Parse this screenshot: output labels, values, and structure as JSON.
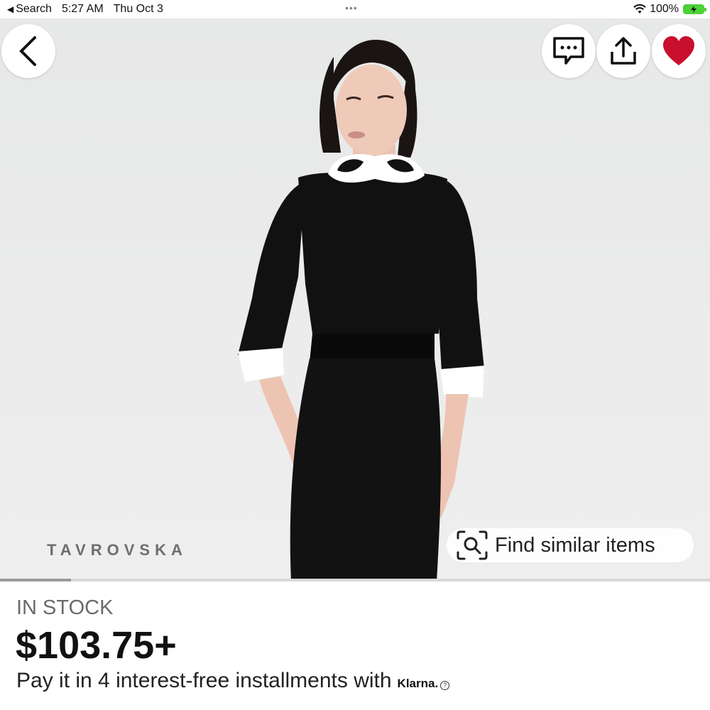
{
  "status_bar": {
    "back_app": "Search",
    "time": "5:27 AM",
    "date": "Thu Oct 3",
    "battery": "100%"
  },
  "photo": {
    "brand_watermark": "TAVROVSKA",
    "find_similar_label": "Find similar items",
    "image_position_fraction": 0.1
  },
  "product": {
    "stock_status": "IN STOCK",
    "price": "$103.75+",
    "installments_text": "Pay it in 4 interest-free installments with",
    "klarna_logo": "Klarna."
  },
  "icons": {
    "back": "chevron-left-icon",
    "message": "chat-bubble-icon",
    "share": "share-icon",
    "favorite": "heart-icon",
    "visual_search": "visual-search-icon"
  },
  "colors": {
    "favorite": "#c8102e",
    "battery": "#4cd137"
  }
}
